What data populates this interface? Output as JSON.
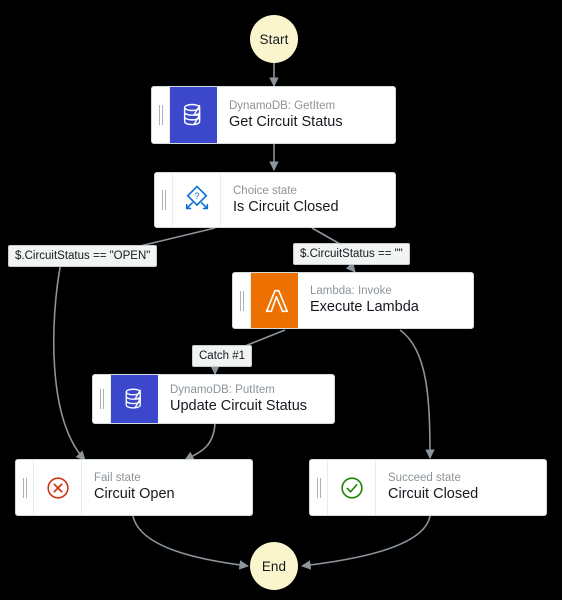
{
  "diagram": {
    "type": "aws-step-functions-workflow",
    "background_color": "#000000",
    "edge_color": "#8c949c",
    "terminal_fill": "#fbf5cd",
    "dynamodb_color": "#3b48cc",
    "lambda_color": "#ed7100",
    "fail_color": "#d13212",
    "succeed_color": "#1d8102",
    "choice_color": "#0972d3"
  },
  "terminals": {
    "start": "Start",
    "end": "End"
  },
  "states": [
    {
      "id": "get-circuit-status",
      "subtitle": "DynamoDB: GetItem",
      "title": "Get Circuit Status",
      "icon": "dynamodb-icon"
    },
    {
      "id": "is-circuit-closed",
      "subtitle": "Choice state",
      "title": "Is Circuit Closed",
      "icon": "choice-icon"
    },
    {
      "id": "execute-lambda",
      "subtitle": "Lambda: Invoke",
      "title": "Execute Lambda",
      "icon": "lambda-icon"
    },
    {
      "id": "update-circuit-status",
      "subtitle": "DynamoDB: PutItem",
      "title": "Update Circuit Status",
      "icon": "dynamodb-icon"
    },
    {
      "id": "circuit-open",
      "subtitle": "Fail state",
      "title": "Circuit Open",
      "icon": "fail-icon"
    },
    {
      "id": "circuit-closed",
      "subtitle": "Succeed state",
      "title": "Circuit Closed",
      "icon": "succeed-icon"
    }
  ],
  "edge_labels": {
    "choice_open": "$.CircuitStatus == \"OPEN\"",
    "choice_empty": "$.CircuitStatus == \"\"",
    "catch": "Catch #1"
  }
}
